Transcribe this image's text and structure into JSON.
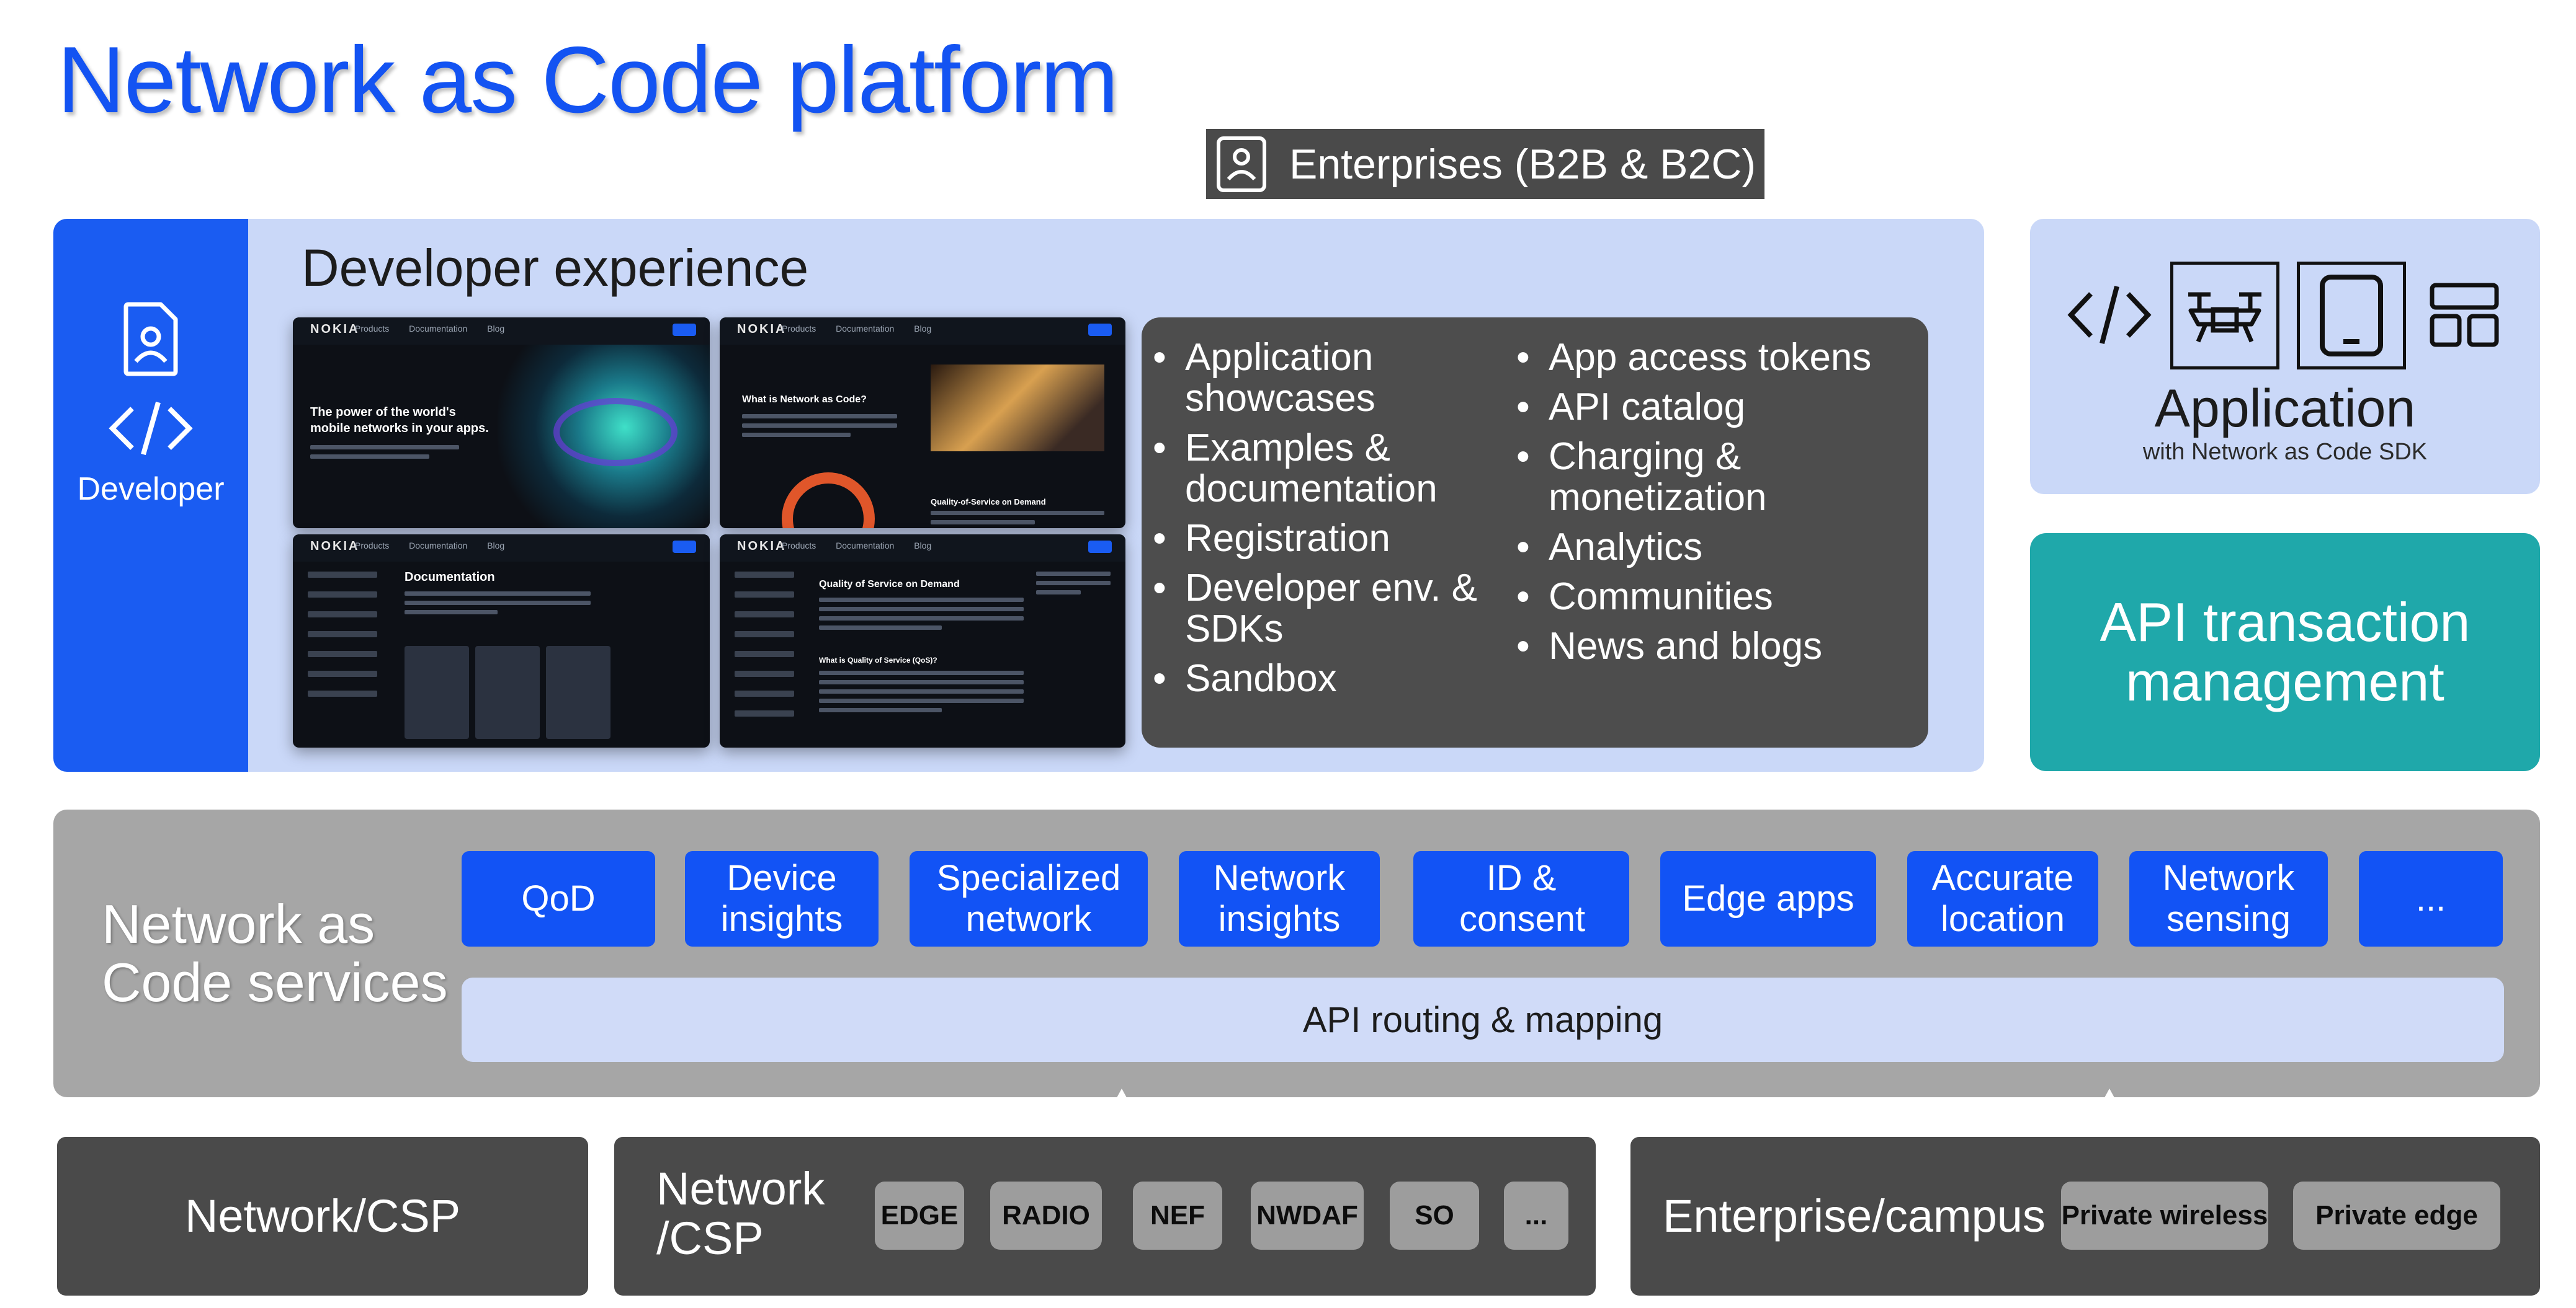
{
  "title": "Network as Code platform",
  "enterprises": "Enterprises (B2B & B2C)",
  "developer": {
    "label": "Developer"
  },
  "developer_experience": {
    "title": "Developer experience",
    "screenshots": [
      {
        "brand": "NOKIA",
        "headline": "The power of the world's mobile networks in your apps."
      },
      {
        "brand": "NOKIA",
        "headline": "What is Network as Code?",
        "caption": "Quality-of-Service on Demand"
      },
      {
        "brand": "NOKIA",
        "headline": "Documentation"
      },
      {
        "brand": "NOKIA",
        "headline": "Quality of Service on Demand",
        "subheadline": "What is Quality of Service (QoS)?"
      }
    ],
    "bullets_left": [
      "Application showcases",
      "Examples & documentation",
      "Registration",
      "Developer env. & SDKs",
      "Sandbox"
    ],
    "bullets_right": [
      "App access tokens",
      "API catalog",
      "Charging & monetization",
      "Analytics",
      "Communities",
      "News and blogs"
    ]
  },
  "application": {
    "title": "Application",
    "subtitle": "with Network as Code SDK",
    "icons": [
      "code-icon",
      "drone-icon",
      "tablet-icon",
      "dashboard-icon"
    ]
  },
  "api_transaction": "API transaction management",
  "services": {
    "title": "Network as Code services",
    "buttons": [
      "QoD",
      "Device insights",
      "Specialized network",
      "Network insights",
      "ID & consent",
      "Edge apps",
      "Accurate location",
      "Network sensing",
      "..."
    ],
    "routing": "API routing & mapping"
  },
  "bottom": {
    "csp1": "Network/CSP",
    "csp2": "Network /CSP",
    "csp2_chips": [
      "EDGE",
      "RADIO",
      "NEF",
      "NWDAF",
      "SO",
      "..."
    ],
    "enterprise": "Enterprise/campus",
    "enterprise_chips": [
      "Private wireless",
      "Private edge"
    ]
  },
  "colors": {
    "brand_blue": "#1a5cf2",
    "panel_blue": "#cad8f8",
    "teal": "#1fa8aa",
    "dark_gray": "#4a4a4a",
    "mid_gray": "#a6a6a6"
  }
}
